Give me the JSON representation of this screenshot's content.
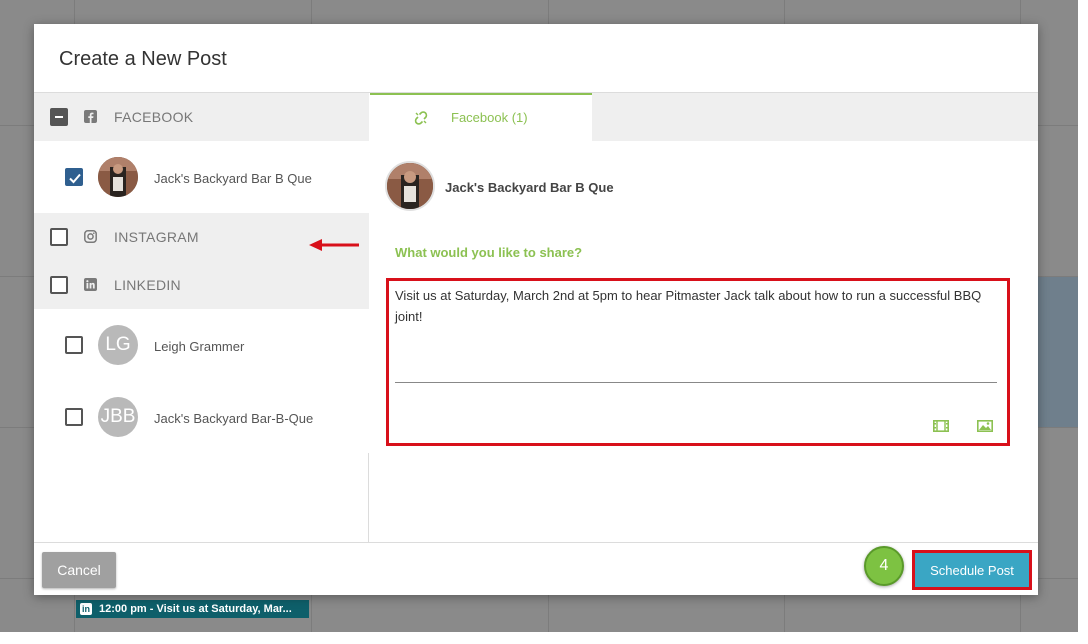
{
  "modal": {
    "title": "Create a New Post"
  },
  "networks": [
    {
      "label": "FACEBOOK",
      "icon": "facebook-icon",
      "state": "indeterminate"
    },
    {
      "label": "INSTAGRAM",
      "icon": "instagram-icon",
      "state": "unchecked"
    },
    {
      "label": "LINKEDIN",
      "icon": "linkedin-icon",
      "state": "unchecked"
    }
  ],
  "accounts": [
    {
      "name": "Jack's Backyard Bar B Que",
      "network": "FACEBOOK",
      "checked": true,
      "avatar": "photo"
    },
    {
      "name": "Leigh Grammer",
      "network": "LINKEDIN",
      "checked": false,
      "avatar": "LG"
    },
    {
      "name": "Jack's Backyard Bar-B-Que",
      "network": "LINKEDIN",
      "checked": false,
      "avatar": "JBB"
    }
  ],
  "tabs": [
    {
      "label": "Facebook (1)",
      "active": true,
      "icon": "unlink-icon"
    }
  ],
  "post": {
    "account_name": "Jack's Backyard Bar B Que",
    "prompt": "What would you like to share?",
    "text": "Visit us at Saturday, March 2nd at 5pm to hear Pitmaster Jack talk about how to run a successful BBQ joint!"
  },
  "footer": {
    "cancel_label": "Cancel",
    "schedule_label": "Schedule Post",
    "step_number": "4"
  },
  "calendar_event": {
    "text": "12:00 pm - Visit us at Saturday, Mar..."
  },
  "colors": {
    "accent_green": "#8cc152",
    "schedule_blue": "#3aa6c4",
    "highlight_red": "#d8101a",
    "checkbox_blue": "#2f5f8f"
  }
}
